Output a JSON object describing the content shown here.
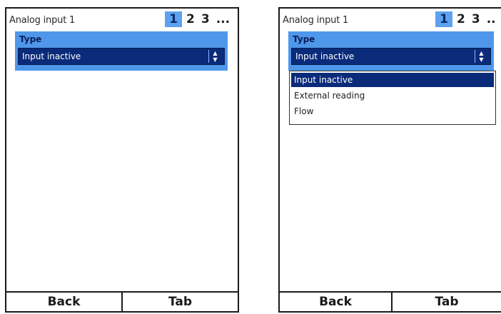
{
  "screens": [
    {
      "title": "Analog input 1",
      "pages": [
        "1",
        "2",
        "3",
        "..."
      ],
      "active_page": "1",
      "field": {
        "label": "Type",
        "value": "Input inactive"
      },
      "softkeys": {
        "back": "Back",
        "tab": "Tab"
      }
    },
    {
      "title": "Analog input 1",
      "pages": [
        "1",
        "2",
        "3",
        ".."
      ],
      "active_page": "1",
      "field": {
        "label": "Type",
        "value": "Input inactive"
      },
      "dropdown": {
        "options": [
          "Input inactive",
          "External reading",
          "Flow"
        ],
        "selected": "Input inactive"
      },
      "softkeys": {
        "back": "Back",
        "tab": "Tab"
      }
    }
  ],
  "colors": {
    "panel": "#4f97ea",
    "select": "#0a2b7a",
    "active_page": "#5da2ee"
  },
  "icons": {
    "stepper": "up-down-arrows-icon"
  }
}
